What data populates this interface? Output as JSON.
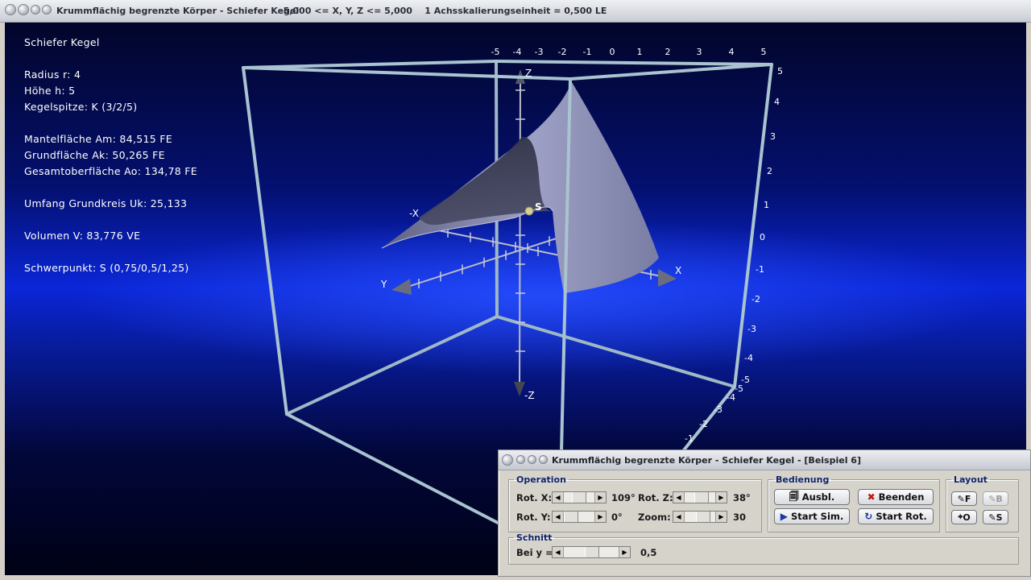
{
  "window": {
    "title": "Krummflächig begrenzte Körper - Schiefer Kegel",
    "range": "-5,000 <= X, Y, Z <= 5,000",
    "scale": "1 Achsskalierungseinheit = 0,500 LE"
  },
  "info": {
    "heading": "Schiefer Kegel",
    "radius": "Radius r: 4",
    "hoehe": "Höhe h: 5",
    "spitze": "Kegelspitze: K (3/2/5)",
    "mantel": "Mantelfläche Am: 84,515 FE",
    "grund": "Grundfläche Ak: 50,265 FE",
    "gesamt": "Gesamtoberfläche Ao: 134,78 FE",
    "umfang": "Umfang Grundkreis Uk: 25,133",
    "volumen": "Volumen V: 83,776 VE",
    "schwerpunkt": "Schwerpunkt: S (0,75/0,5/1,25)"
  },
  "axes": {
    "x_label": "X",
    "neg_x_label": "-X",
    "y_label": "Y",
    "z_label": "Z",
    "neg_z_label": "-Z",
    "point_label": "S",
    "top_ticks": [
      "-5",
      "-4",
      "-3",
      "-2",
      "-1",
      "0",
      "1",
      "2",
      "3",
      "4",
      "5"
    ],
    "right_ticks": [
      "5",
      "4",
      "3",
      "2",
      "1",
      "0",
      "-1",
      "-2",
      "-3",
      "-4",
      "-5"
    ],
    "bottom_ticks": [
      "-5",
      "-4",
      "-3",
      "-2",
      "-1"
    ]
  },
  "panel": {
    "title": "Krummflächig begrenzte Körper - Schiefer Kegel - [Beispiel 6]",
    "operation": {
      "legend": "Operation",
      "rot_x_label": "Rot. X:",
      "rot_x_value": "109°",
      "rot_y_label": "Rot. Y:",
      "rot_y_value": "0°",
      "rot_z_label": "Rot. Z:",
      "rot_z_value": "38°",
      "zoom_label": "Zoom:",
      "zoom_value": "30"
    },
    "bedienung": {
      "legend": "Bedienung",
      "ausbl": "Ausbl.",
      "beenden": "Beenden",
      "start_sim": "Start Sim.",
      "start_rot": "Start Rot."
    },
    "layout": {
      "legend": "Layout",
      "f": "F",
      "b": "B",
      "o": "O",
      "s": "S"
    },
    "schnitt": {
      "legend": "Schnitt",
      "bei_label": "Bei y =",
      "bei_value": "0,5"
    }
  },
  "colors": {
    "frame": "#a9c3d0",
    "cone": "#8c8fb6"
  }
}
